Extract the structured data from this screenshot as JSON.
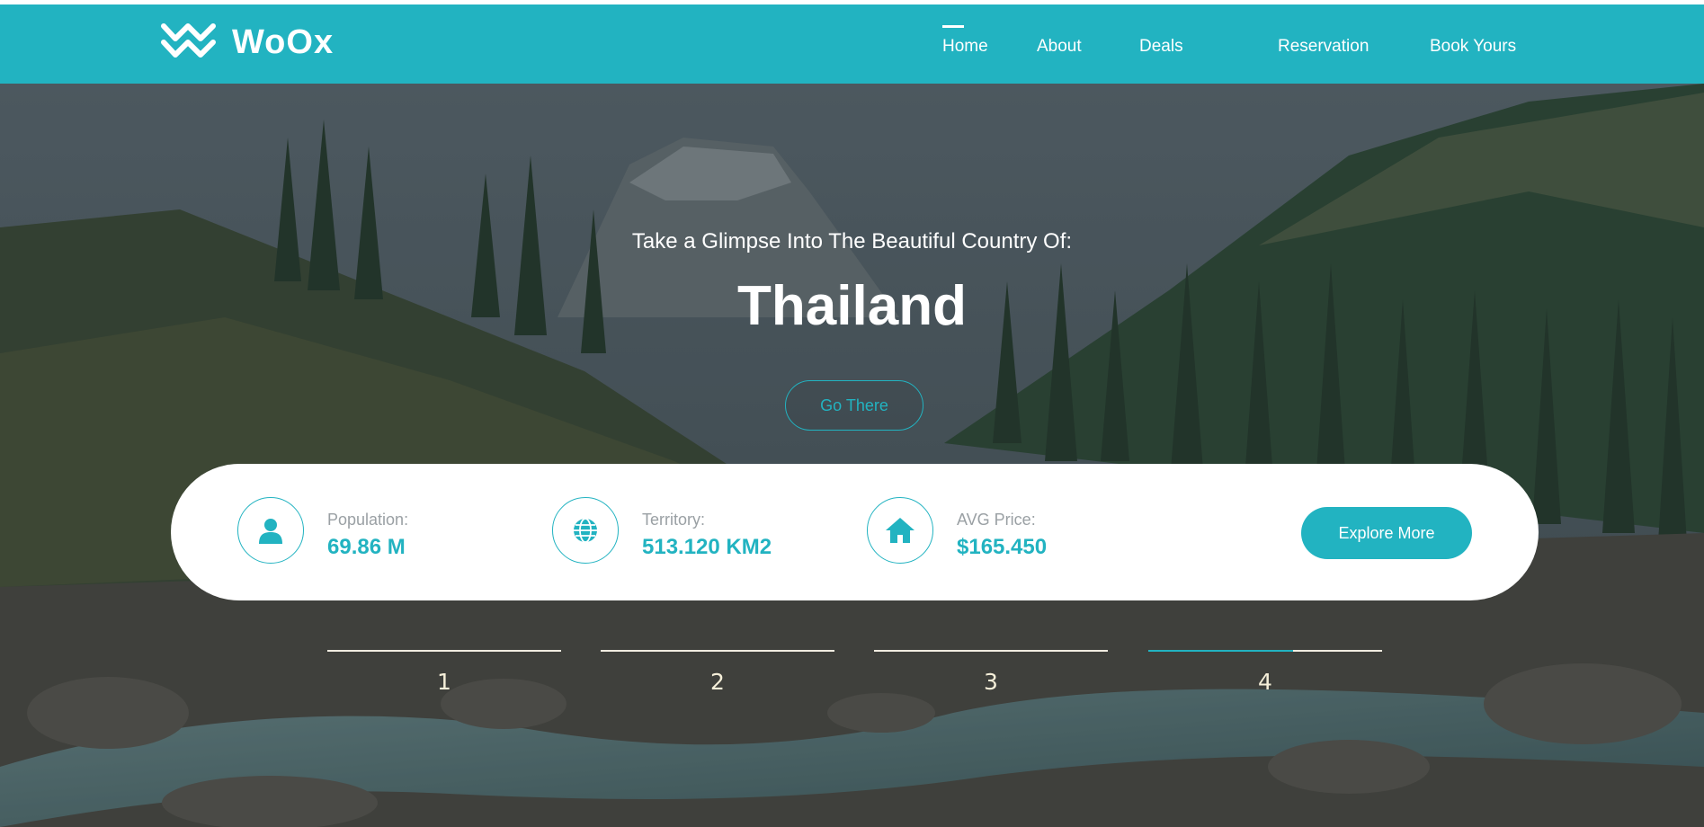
{
  "header": {
    "logo_text": "WoOx",
    "nav": [
      {
        "label": "Home",
        "active": true
      },
      {
        "label": "About",
        "active": false
      },
      {
        "label": "Deals",
        "active": false
      },
      {
        "label": "Reservation",
        "active": false
      },
      {
        "label": "Book Yours",
        "active": false
      }
    ]
  },
  "hero": {
    "subtitle": "Take a Glimpse Into The Beautiful Country Of:",
    "title": "Thailand",
    "cta_label": "Go There"
  },
  "info": {
    "population": {
      "label": "Population:",
      "value": "69.86 M",
      "icon": "user-icon"
    },
    "territory": {
      "label": "Territory:",
      "value": "513.120 KM2",
      "icon": "globe-icon"
    },
    "avg_price": {
      "label": "AVG Price:",
      "value": "$165.450",
      "icon": "home-icon"
    },
    "explore_label": "Explore More"
  },
  "slider": {
    "indicators": [
      {
        "label": "1",
        "progress": 0
      },
      {
        "label": "2",
        "progress": 0
      },
      {
        "label": "3",
        "progress": 0
      },
      {
        "label": "4",
        "progress": 0.62
      }
    ]
  },
  "colors": {
    "accent": "#22b3c1",
    "white": "#ffffff",
    "muted_text": "#9aa0a4"
  }
}
